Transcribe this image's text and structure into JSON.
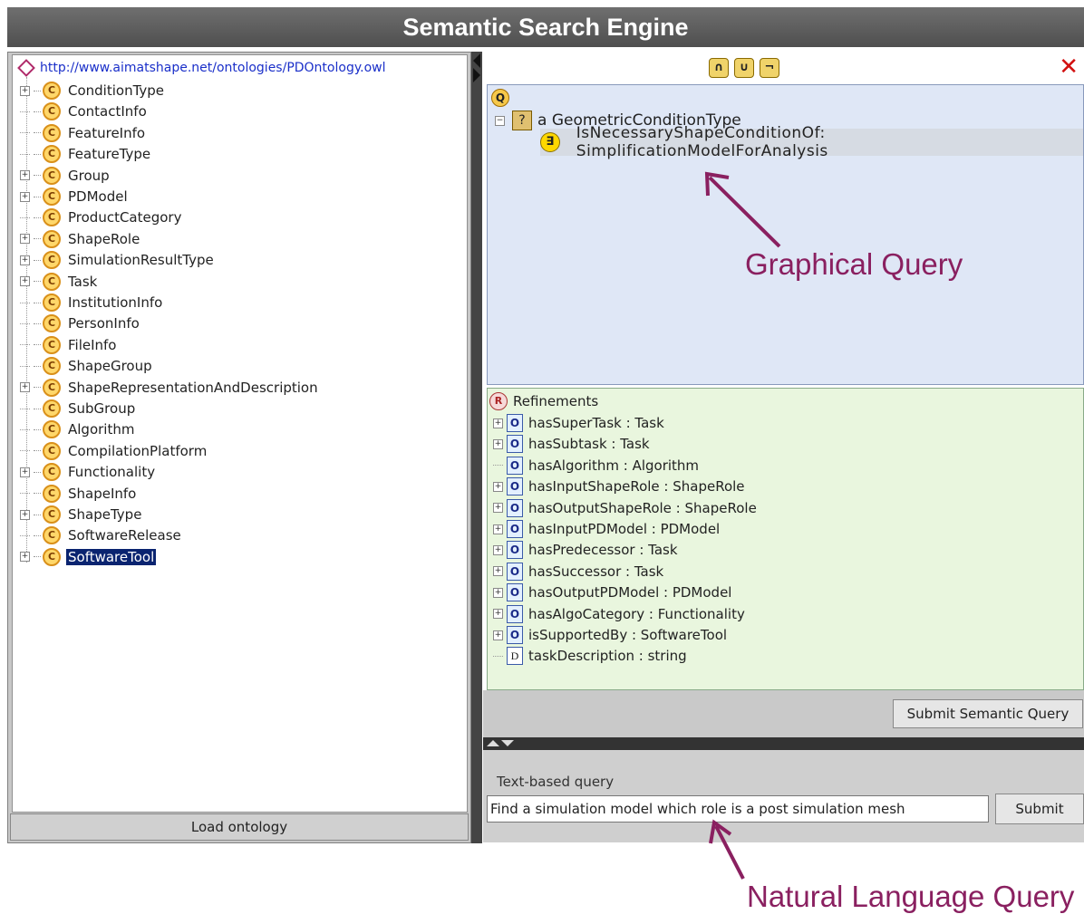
{
  "title": "Semantic Search Engine",
  "ontology": {
    "root_url": "http://www.aimatshape.net/ontologies/PDOntology.owl",
    "classes": [
      {
        "label": "ConditionType",
        "expandable": true,
        "selected": false
      },
      {
        "label": "ContactInfo",
        "expandable": false,
        "selected": false
      },
      {
        "label": "FeatureInfo",
        "expandable": false,
        "selected": false
      },
      {
        "label": "FeatureType",
        "expandable": false,
        "selected": false
      },
      {
        "label": "Group",
        "expandable": true,
        "selected": false
      },
      {
        "label": "PDModel",
        "expandable": true,
        "selected": false
      },
      {
        "label": "ProductCategory",
        "expandable": false,
        "selected": false
      },
      {
        "label": "ShapeRole",
        "expandable": true,
        "selected": false
      },
      {
        "label": "SimulationResultType",
        "expandable": true,
        "selected": false
      },
      {
        "label": "Task",
        "expandable": true,
        "selected": false
      },
      {
        "label": "InstitutionInfo",
        "expandable": false,
        "selected": false
      },
      {
        "label": "PersonInfo",
        "expandable": false,
        "selected": false
      },
      {
        "label": "FileInfo",
        "expandable": false,
        "selected": false
      },
      {
        "label": "ShapeGroup",
        "expandable": false,
        "selected": false
      },
      {
        "label": "ShapeRepresentationAndDescription",
        "expandable": true,
        "selected": false
      },
      {
        "label": "SubGroup",
        "expandable": false,
        "selected": false
      },
      {
        "label": "Algorithm",
        "expandable": false,
        "selected": false
      },
      {
        "label": "CompilationPlatform",
        "expandable": false,
        "selected": false
      },
      {
        "label": "Functionality",
        "expandable": true,
        "selected": false
      },
      {
        "label": "ShapeInfo",
        "expandable": false,
        "selected": false
      },
      {
        "label": "ShapeType",
        "expandable": true,
        "selected": false
      },
      {
        "label": "SoftwareRelease",
        "expandable": false,
        "selected": false
      },
      {
        "label": "SoftwareTool",
        "expandable": true,
        "selected": true
      }
    ],
    "load_button": "Load ontology",
    "class_icon_letter": "C"
  },
  "query": {
    "toolbar_buttons": [
      "∩",
      "∪",
      "¬"
    ],
    "close_glyph": "✕",
    "root_icon_letter": "Q",
    "node_icon": "?",
    "node_text": "a GeometricConditionType",
    "restriction_icon": "∃",
    "restriction_text": "IsNecessaryShapeConditionOf: SimplificationModelForAnalysis"
  },
  "refinements": {
    "header": "Refinements",
    "header_icon": "R",
    "items": [
      {
        "label": "hasSuperTask : Task",
        "kind": "O",
        "expandable": true
      },
      {
        "label": "hasSubtask : Task",
        "kind": "O",
        "expandable": true
      },
      {
        "label": "hasAlgorithm : Algorithm",
        "kind": "O",
        "expandable": false
      },
      {
        "label": "hasInputShapeRole : ShapeRole",
        "kind": "O",
        "expandable": true
      },
      {
        "label": "hasOutputShapeRole : ShapeRole",
        "kind": "O",
        "expandable": true
      },
      {
        "label": "hasInputPDModel : PDModel",
        "kind": "O",
        "expandable": true
      },
      {
        "label": "hasPredecessor : Task",
        "kind": "O",
        "expandable": true
      },
      {
        "label": "hasSuccessor : Task",
        "kind": "O",
        "expandable": true
      },
      {
        "label": "hasOutputPDModel : PDModel",
        "kind": "O",
        "expandable": true
      },
      {
        "label": "hasAlgoCategory : Functionality",
        "kind": "O",
        "expandable": true
      },
      {
        "label": "isSupportedBy : SoftwareTool",
        "kind": "O",
        "expandable": true
      },
      {
        "label": "taskDescription : string",
        "kind": "D",
        "expandable": false
      }
    ]
  },
  "submit_semantic_label": "Submit Semantic Query",
  "text_query": {
    "label": "Text-based query",
    "value": "Find a simulation model which role is a post simulation mesh",
    "submit_label": "Submit"
  },
  "annotations": {
    "graphical": "Graphical Query",
    "natural": "Natural Language Query"
  },
  "colors": {
    "annotation": "#8a2060",
    "query_bg": "#dfe7f6",
    "refine_bg": "#e9f6de",
    "selection": "#0a2470"
  }
}
